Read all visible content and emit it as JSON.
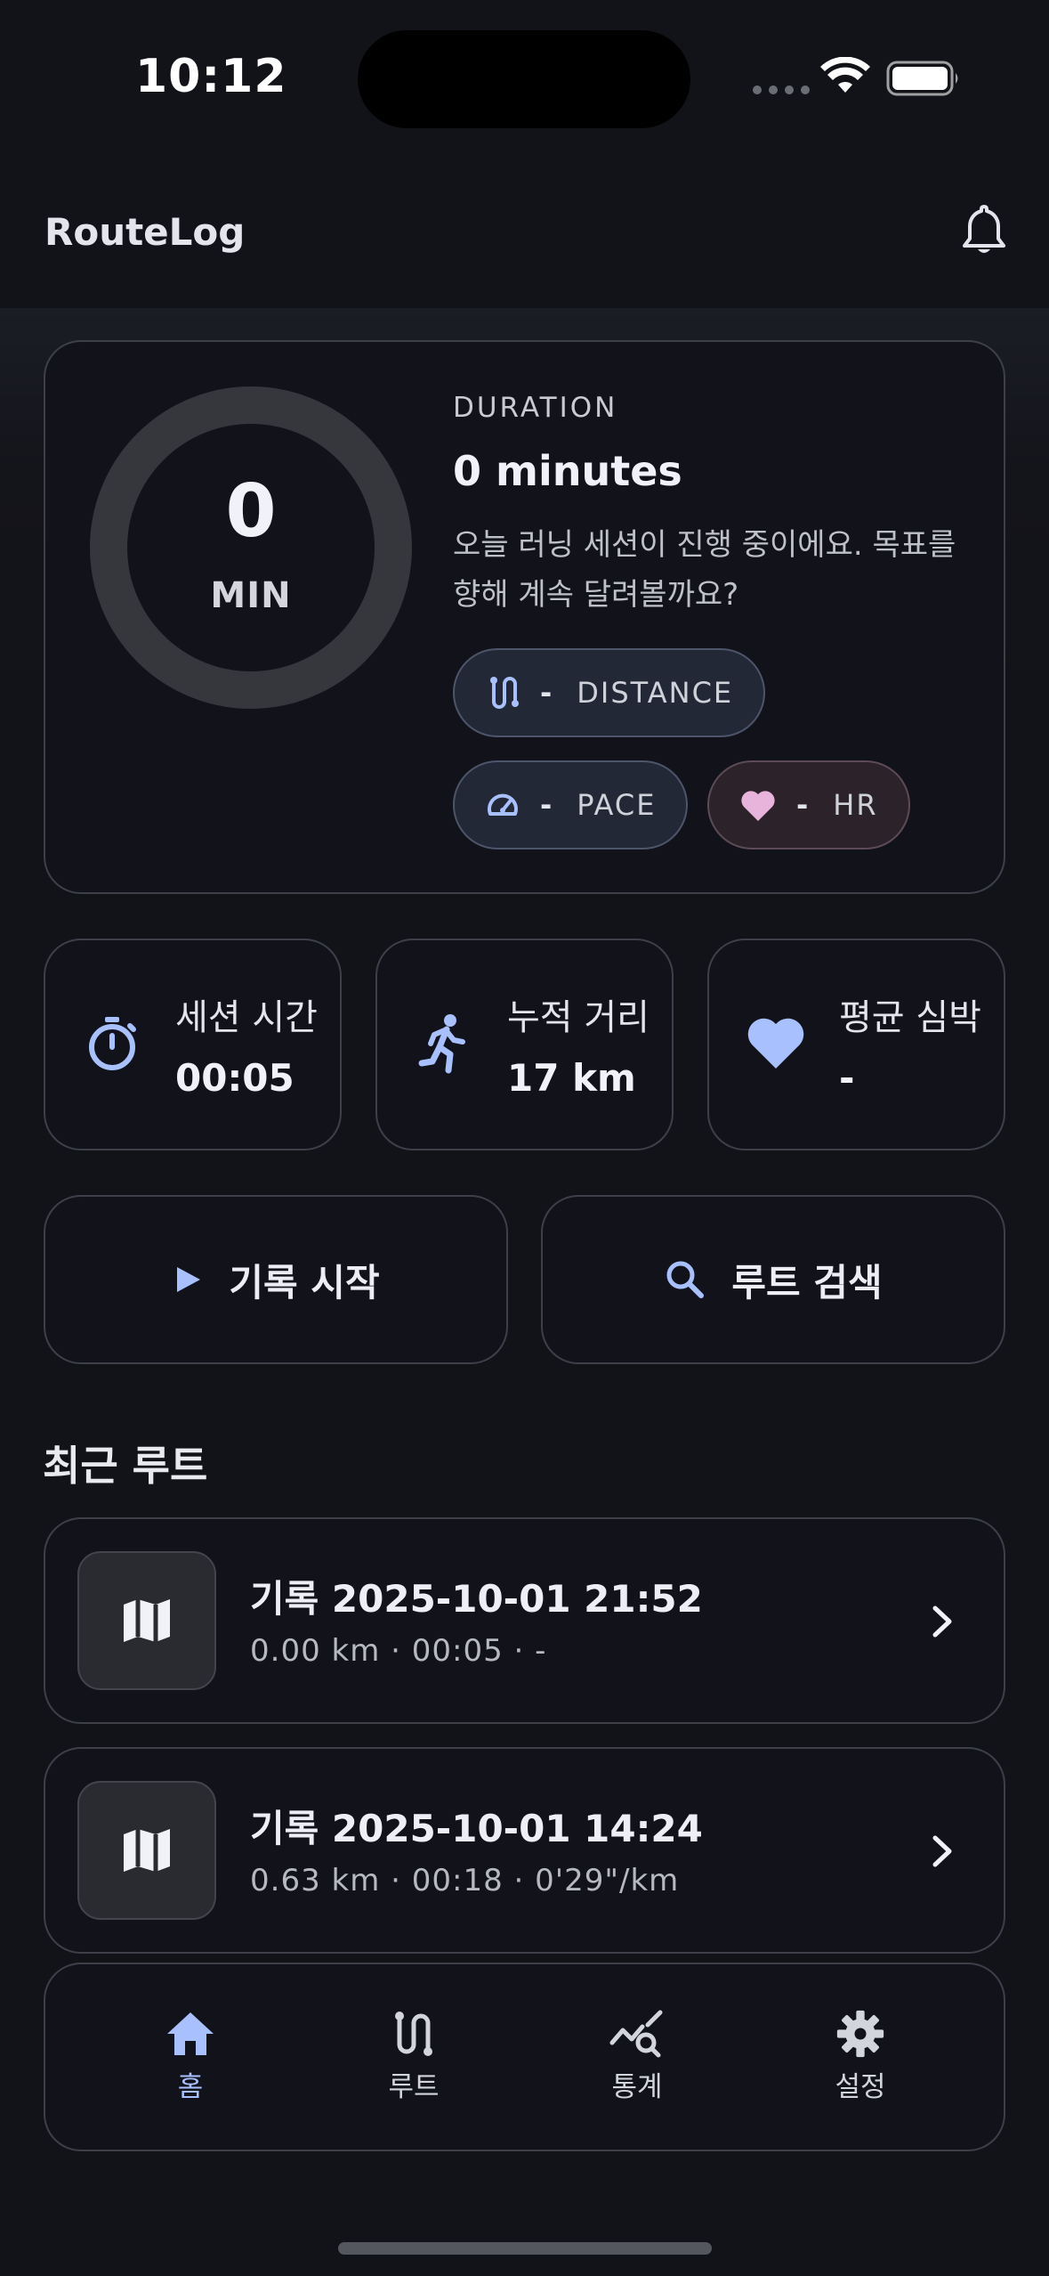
{
  "status_bar": {
    "time": "10:12"
  },
  "app_bar": {
    "title": "RouteLog"
  },
  "hero": {
    "ring_value": "0",
    "ring_unit": "MIN",
    "duration_label": "DURATION",
    "duration_value": "0 minutes",
    "description": "오늘 러닝 세션이 진행 중이에요. 목표를 향해 계속 달려볼까요?",
    "chips": [
      {
        "value": "-",
        "label": "DISTANCE",
        "icon": "route-icon"
      },
      {
        "value": "-",
        "label": "PACE",
        "icon": "speedometer-icon"
      },
      {
        "value": "-",
        "label": "HR",
        "icon": "heart-icon"
      }
    ]
  },
  "stats": [
    {
      "label": "세션 시간",
      "value": "00:05",
      "icon": "stopwatch-icon"
    },
    {
      "label": "누적 거리",
      "value": "17 km",
      "icon": "running-icon"
    },
    {
      "label": "평균 심박",
      "value": "-",
      "icon": "heart-icon"
    }
  ],
  "actions": {
    "start_label": "기록 시작",
    "search_label": "루트 검색"
  },
  "recent": {
    "title": "최근 루트",
    "routes": [
      {
        "title": "기록 2025-10-01 21:52",
        "meta": "0.00 km · 00:05 · -"
      },
      {
        "title": "기록 2025-10-01 14:24",
        "meta": "0.63 km · 00:18 · 0'29\"/km"
      }
    ]
  },
  "nav": {
    "items": [
      {
        "label": "홈",
        "icon": "home-icon",
        "active": true
      },
      {
        "label": "루트",
        "icon": "route-icon",
        "active": false
      },
      {
        "label": "통계",
        "icon": "stats-search-icon",
        "active": false
      },
      {
        "label": "설정",
        "icon": "gear-icon",
        "active": false
      }
    ]
  },
  "colors": {
    "background": "#121318",
    "accent": "#A9C0FF",
    "accent_pink": "#E8B4DC",
    "ring_track": "#35373d",
    "card_border": "#3d4049"
  }
}
